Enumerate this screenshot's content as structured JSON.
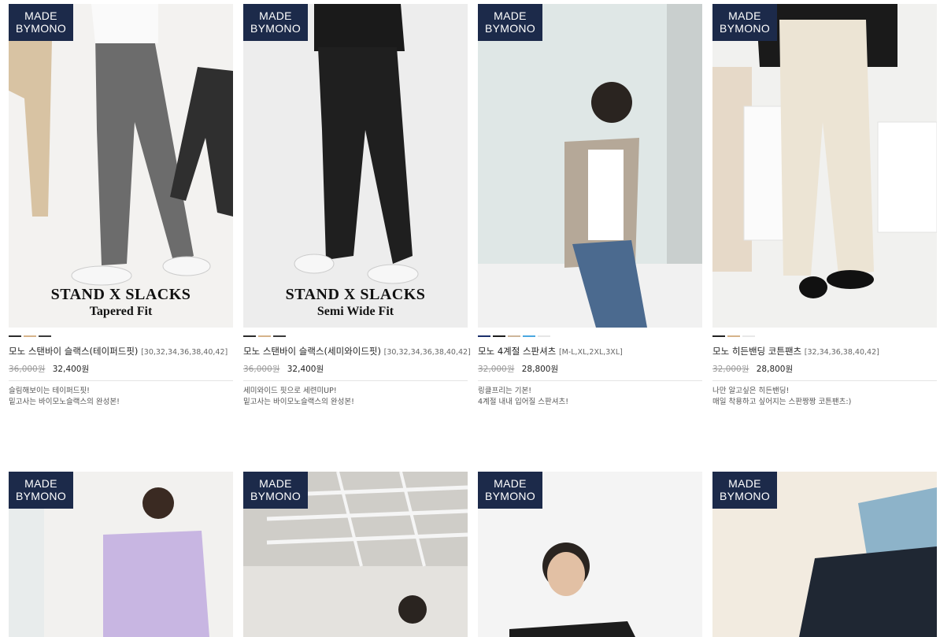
{
  "badge": {
    "line1": "MADE",
    "line2": "BYMONO"
  },
  "colors": {
    "badge_bg": "#1c2a4a"
  },
  "products_row1": [
    {
      "name": "모노 스탠바이 슬랙스(테이퍼드핏)",
      "sizes": "[30,32,34,36,38,40,42]",
      "old_price": "36,000원",
      "price": "32,400원",
      "desc1": "슬림해보이는 테이퍼드핏!",
      "desc2": "밑고사는 바이모노슬랙스의 완성본!",
      "banner1": "STAND X SLACKS",
      "banner2": "Tapered Fit",
      "swatches": [
        "#2b2b2b",
        "#d5b38a",
        "#3a3a3a"
      ]
    },
    {
      "name": "모노 스탠바이 슬랙스(세미와이드핏)",
      "sizes": "[30,32,34,36,38,40,42]",
      "old_price": "36,000원",
      "price": "32,400원",
      "desc1": "세미와이드 핏으로 세련미UP!",
      "desc2": "밑고사는 바이모노슬랙스의 완성본!",
      "banner1": "STAND X SLACKS",
      "banner2": "Semi Wide Fit",
      "swatches": [
        "#2b2b2b",
        "#d5b38a",
        "#3a3a3a"
      ]
    },
    {
      "name": "모노 4계절 스판셔츠",
      "sizes": "[M-L,XL,2XL,3XL]",
      "old_price": "32,000원",
      "price": "28,800원",
      "desc1": "링클프리는 기본!",
      "desc2": "4계절 내내 입어질 스판셔츠!",
      "banner1": "",
      "banner2": "",
      "swatches": [
        "#1b2f6b",
        "#1c1c1c",
        "#cdb69a",
        "#4aa7e0",
        "#e6e6e6"
      ]
    },
    {
      "name": "모노 히든밴딩 코튼팬츠",
      "sizes": "[32,34,36,38,40,42]",
      "old_price": "32,000원",
      "price": "28,800원",
      "desc1": "나만 알고싶은 히든밴딩!",
      "desc2": "매일 착용하고 싶어지는 스판짱짱 코튼팬츠:)",
      "banner1": "",
      "banner2": "",
      "swatches": [
        "#222222",
        "#d5b38a",
        "#e8e8e8"
      ]
    }
  ]
}
